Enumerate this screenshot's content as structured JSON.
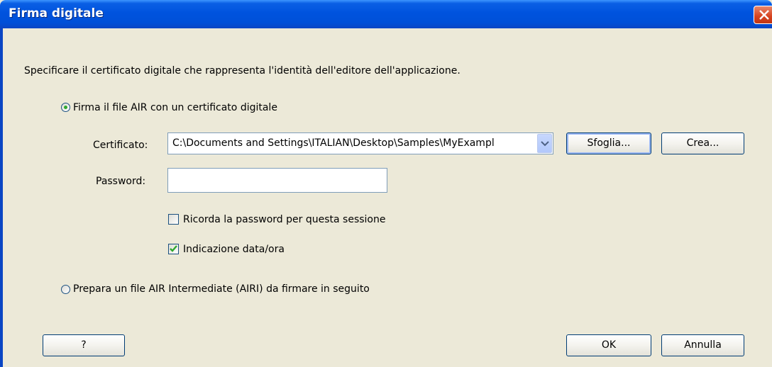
{
  "window": {
    "title": "Firma digitale"
  },
  "instruction": "Specificare il certificato digitale che rappresenta l'identità dell'editore dell'applicazione.",
  "option_sign": {
    "label": "Firma il file AIR con un certificato digitale",
    "selected": true
  },
  "certificate": {
    "label": "Certificato:",
    "value": "C:\\Documents and Settings\\ITALIAN\\Desktop\\Samples\\MyExampl"
  },
  "buttons": {
    "browse": "Sfoglia...",
    "create": "Crea...",
    "help": "?",
    "ok": "OK",
    "cancel": "Annulla"
  },
  "password": {
    "label": "Password:",
    "value": ""
  },
  "remember_password": {
    "label": "Ricorda la password per questa sessione",
    "checked": false
  },
  "timestamp": {
    "label": "Indicazione data/ora",
    "checked": true
  },
  "option_prepare": {
    "label": "Prepara un file AIR Intermediate (AIRI) da firmare in seguito",
    "selected": false
  },
  "colors": {
    "titlebar": "#0053de",
    "dialog_bg": "#ece9d8",
    "check_green": "#2fa82f"
  }
}
